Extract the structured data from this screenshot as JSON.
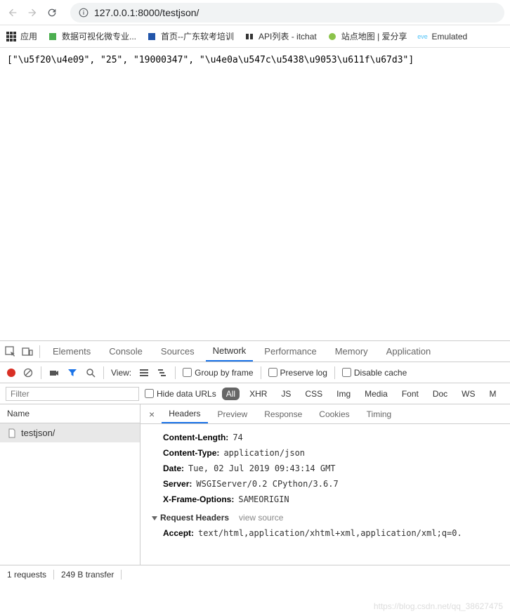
{
  "browser": {
    "url": "127.0.0.1:8000/testjson/"
  },
  "bookmarks": {
    "apps": "应用",
    "items": [
      "数据可视化微专业...",
      "首页--广东软考培训",
      "API列表 - itchat",
      "站点地图 | 爱分享",
      "Emulated"
    ]
  },
  "page_body": "[\"\\u5f20\\u4e09\", \"25\", \"19000347\", \"\\u4e0a\\u547c\\u5438\\u9053\\u611f\\u67d3\"]",
  "devtools": {
    "tabs": [
      "Elements",
      "Console",
      "Sources",
      "Network",
      "Performance",
      "Memory",
      "Application"
    ],
    "active_tab": "Network"
  },
  "network_toolbar": {
    "view_label": "View:",
    "group_by_frame": "Group by frame",
    "preserve_log": "Preserve log",
    "disable_cache": "Disable cache"
  },
  "filter": {
    "placeholder": "Filter",
    "hide_data_urls": "Hide data URLs",
    "types": [
      "All",
      "XHR",
      "JS",
      "CSS",
      "Img",
      "Media",
      "Font",
      "Doc",
      "WS",
      "M"
    ],
    "active_type": "All"
  },
  "requests": {
    "header": "Name",
    "items": [
      "testjson/"
    ]
  },
  "details": {
    "tabs": [
      "Headers",
      "Preview",
      "Response",
      "Cookies",
      "Timing"
    ],
    "active_tab": "Headers",
    "response_headers": [
      {
        "key": "Content-Length:",
        "val": "74"
      },
      {
        "key": "Content-Type:",
        "val": "application/json"
      },
      {
        "key": "Date:",
        "val": "Tue, 02 Jul 2019 09:43:14 GMT"
      },
      {
        "key": "Server:",
        "val": "WSGIServer/0.2 CPython/3.6.7"
      },
      {
        "key": "X-Frame-Options:",
        "val": "SAMEORIGIN"
      }
    ],
    "request_headers_title": "Request Headers",
    "view_source": "view source",
    "request_headers": [
      {
        "key": "Accept:",
        "val": "text/html,application/xhtml+xml,application/xml;q=0."
      }
    ]
  },
  "status_bar": {
    "requests": "1 requests",
    "transfer": "249 B transfer"
  },
  "watermark": "https://blog.csdn.net/qq_38627475"
}
